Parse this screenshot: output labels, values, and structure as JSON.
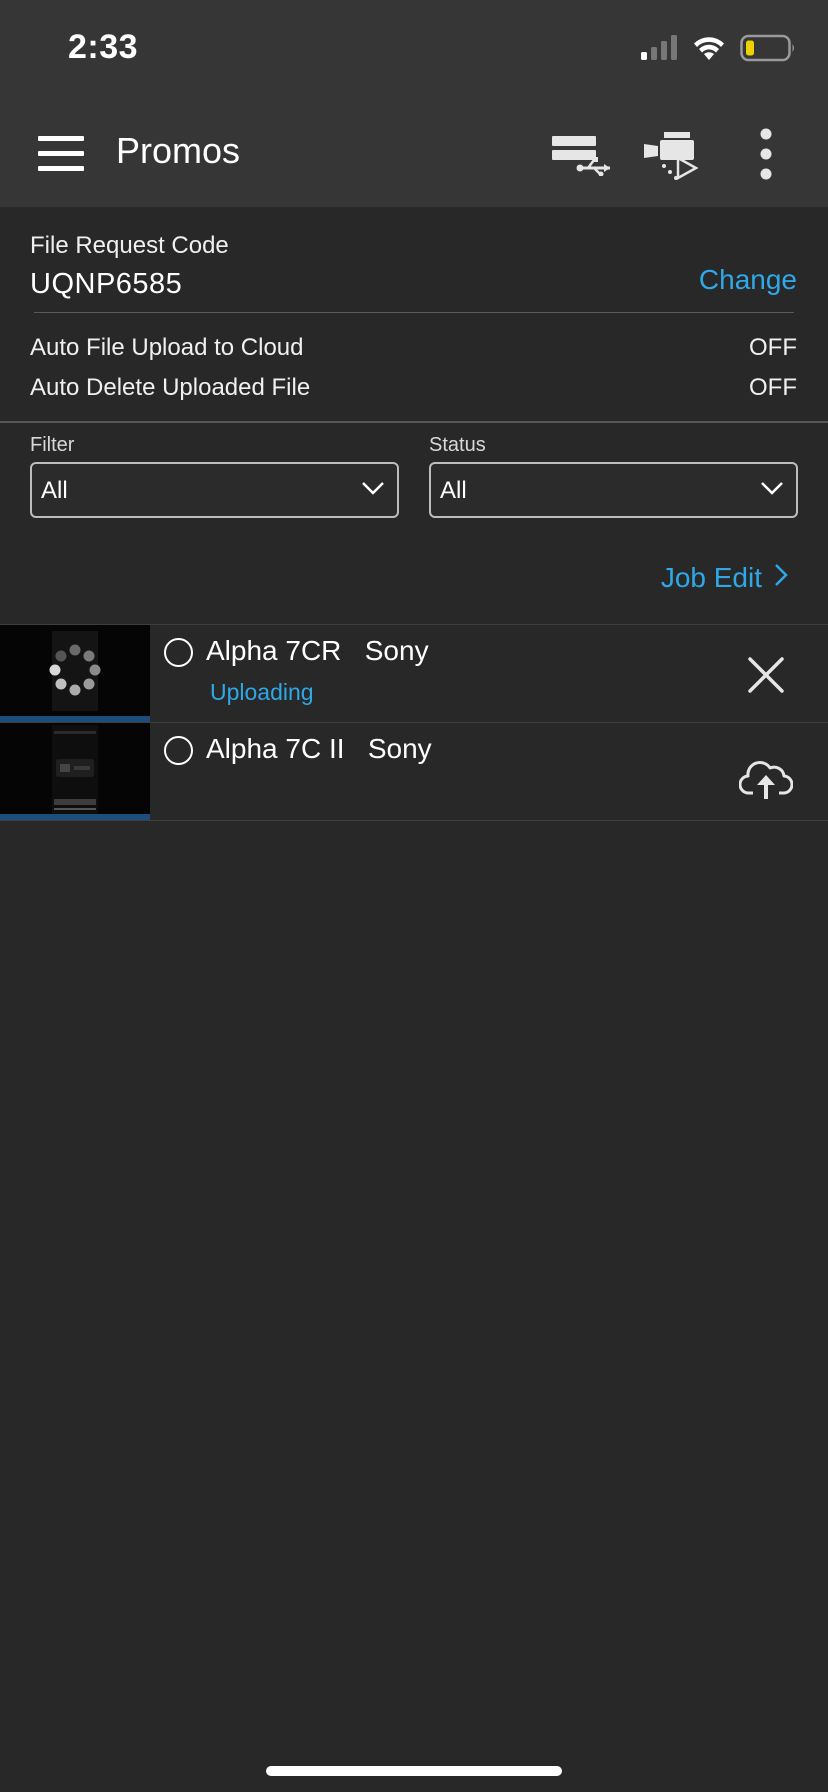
{
  "status_bar": {
    "time": "2:33",
    "icons": [
      "cellular-signal-icon",
      "wifi-icon",
      "battery-low-icon"
    ]
  },
  "nav": {
    "title": "Promos",
    "icons": [
      "hamburger-menu-icon",
      "usb-connection-icon",
      "camera-transfer-icon",
      "more-vertical-icon"
    ]
  },
  "file_request": {
    "title": "File Request Code",
    "code": "UQNP6585",
    "change_label": "Change"
  },
  "settings": [
    {
      "label": "Auto File Upload to Cloud",
      "value": "OFF"
    },
    {
      "label": "Auto Delete Uploaded File",
      "value": "OFF"
    }
  ],
  "filters": {
    "filter_label": "Filter",
    "filter_value": "All",
    "status_label": "Status",
    "status_value": "All"
  },
  "job_edit_label": "Job Edit",
  "items": [
    {
      "name": "Alpha 7CR   Sony",
      "status": "Uploading",
      "action_icon": "close-icon",
      "thumbnail": "loading-spinner-thumbnail"
    },
    {
      "name": "Alpha 7C II   Sony",
      "status": "",
      "action_icon": "cloud-upload-icon",
      "thumbnail": "camera-video-thumbnail"
    }
  ],
  "colors": {
    "background": "#282828",
    "bar_background": "#363636",
    "accent": "#2ea8e6",
    "text": "#ffffff"
  }
}
